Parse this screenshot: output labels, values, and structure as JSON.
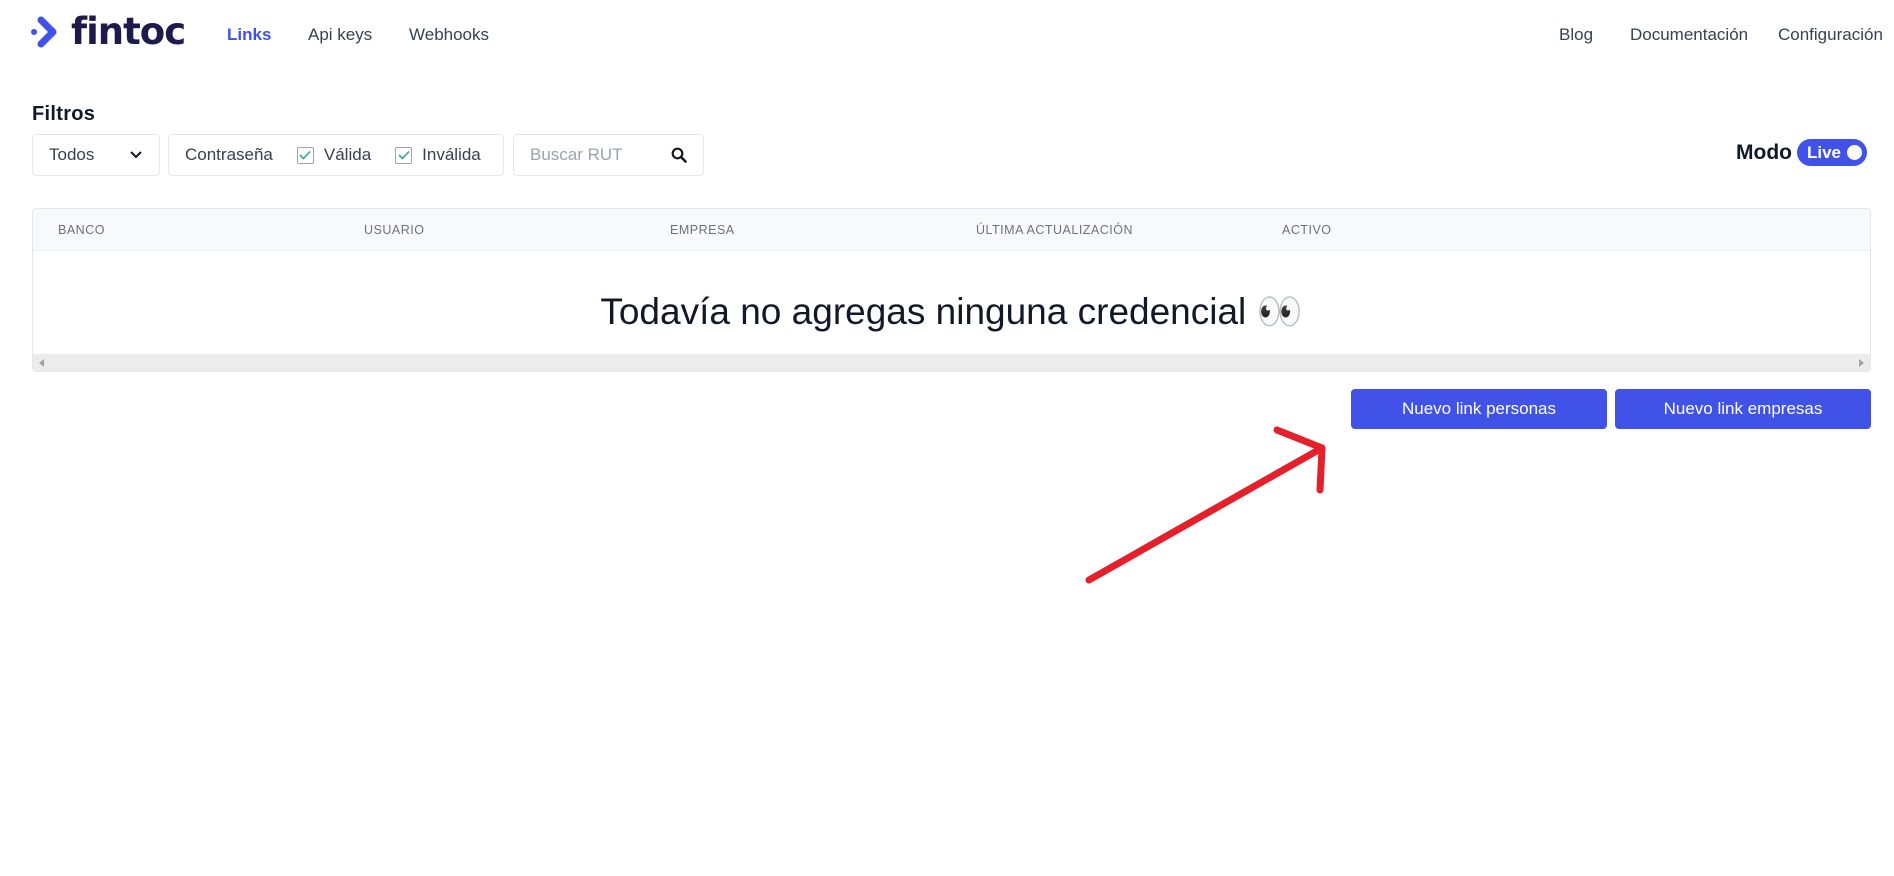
{
  "header": {
    "brand": "fintoc",
    "nav": [
      {
        "label": "Links",
        "active": true
      },
      {
        "label": "Api keys",
        "active": false
      },
      {
        "label": "Webhooks",
        "active": false
      }
    ],
    "right_links": [
      "Blog",
      "Documentación",
      "Configuración"
    ]
  },
  "filters": {
    "title": "Filtros",
    "select_value": "Todos",
    "password_label": "Contraseña",
    "valid_label": "Válida",
    "invalid_label": "Inválida",
    "search_placeholder": "Buscar RUT",
    "mode_label": "Modo",
    "mode_value": "Live"
  },
  "table": {
    "columns": [
      "BANCO",
      "USUARIO",
      "EMPRESA",
      "ÚLTIMA ACTUALIZACIÓN",
      "ACTIVO"
    ],
    "empty_message": "Todavía no agregas ninguna credencial 👀"
  },
  "actions": {
    "new_person_link": "Nuevo link personas",
    "new_company_link": "Nuevo link empresas"
  },
  "colors": {
    "accent": "#4052e8",
    "brand_dark": "#1d1b4b",
    "annotation": "#e5202a"
  }
}
